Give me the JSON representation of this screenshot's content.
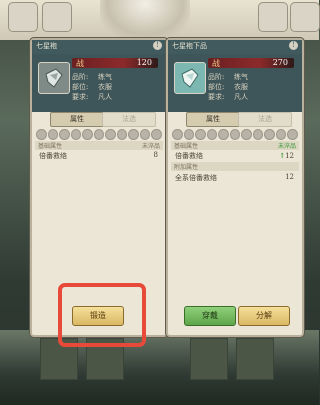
{
  "left_panel": {
    "title": "七星袍",
    "power_label": "战",
    "power_value": "120",
    "stats": [
      {
        "label": "品阶:",
        "value": "练气"
      },
      {
        "label": "部位:",
        "value": "衣服"
      },
      {
        "label": "要求:",
        "value": "凡人"
      }
    ],
    "tab_active": "属性",
    "tab_inactive": "法选",
    "section_basic": {
      "label": "基础属性",
      "tag": "未淬品"
    },
    "rows": [
      {
        "label": "倍番救络",
        "value": "8"
      }
    ],
    "forge_button": "锻造"
  },
  "right_panel": {
    "title": "七星袍下品",
    "power_label": "战",
    "power_value": "270",
    "stats": [
      {
        "label": "品阶:",
        "value": "练气"
      },
      {
        "label": "部位:",
        "value": "衣服"
      },
      {
        "label": "要求:",
        "value": "凡人"
      }
    ],
    "tab_active": "属性",
    "tab_inactive": "法选",
    "section_basic": {
      "label": "基础属性",
      "tag": "未淬品"
    },
    "rows": [
      {
        "label": "倍番救络",
        "value": "12",
        "arrow": "↑"
      }
    ],
    "section_extra": {
      "label": "附加属性"
    },
    "extra_rows": [
      {
        "label": "全系倍番救络",
        "value": "12"
      }
    ],
    "equip_button": "穿戴",
    "split_button": "分解"
  },
  "colors": {
    "header": "#415a5e",
    "power_bar": "#8c2a2b",
    "highlight": "#e84a3a",
    "equip_green": "#5ea54a",
    "gold": "#d9b863"
  },
  "icons": [
    "info-icon",
    "robe-icon",
    "gem-slot-icon",
    "up-arrow-icon"
  ]
}
